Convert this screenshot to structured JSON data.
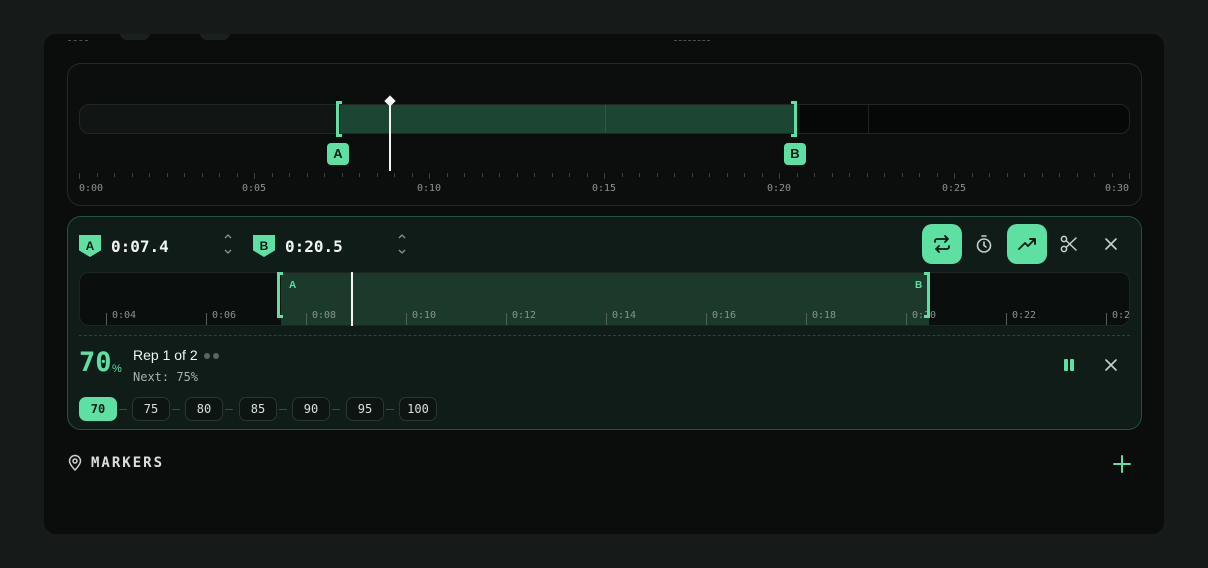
{
  "overview": {
    "ticks": [
      "0:00",
      "0:05",
      "0:10",
      "0:15",
      "0:20",
      "0:25",
      "0:30"
    ],
    "point_a_tag": "A",
    "point_b_tag": "B"
  },
  "loop": {
    "a_label": "A",
    "a_time": "0:07.4",
    "b_label": "B",
    "b_time": "0:20.5",
    "zoom_a": "A",
    "zoom_b": "B",
    "zoom_ticks": [
      "0:04",
      "0:06",
      "0:08",
      "0:10",
      "0:12",
      "0:14",
      "0:16",
      "0:18",
      "0:20",
      "0:22",
      "0:2"
    ],
    "speed_value": "70",
    "speed_unit": "%",
    "rep_text": "Rep 1 of 2",
    "next_text": "Next: 75%",
    "speed_steps": [
      "70",
      "75",
      "80",
      "85",
      "90",
      "95",
      "100"
    ],
    "active_step": "70"
  },
  "markers": {
    "label": "MARKERS"
  },
  "colors": {
    "accent": "#5ee0a3",
    "background": "#0a0d0c",
    "loop_bg": "#0f1c17"
  },
  "icons": [
    "loop-icon",
    "timer-icon",
    "trending-up-icon",
    "scissors-icon",
    "close-icon",
    "pause-icon",
    "location-pin-icon",
    "plus-icon"
  ]
}
